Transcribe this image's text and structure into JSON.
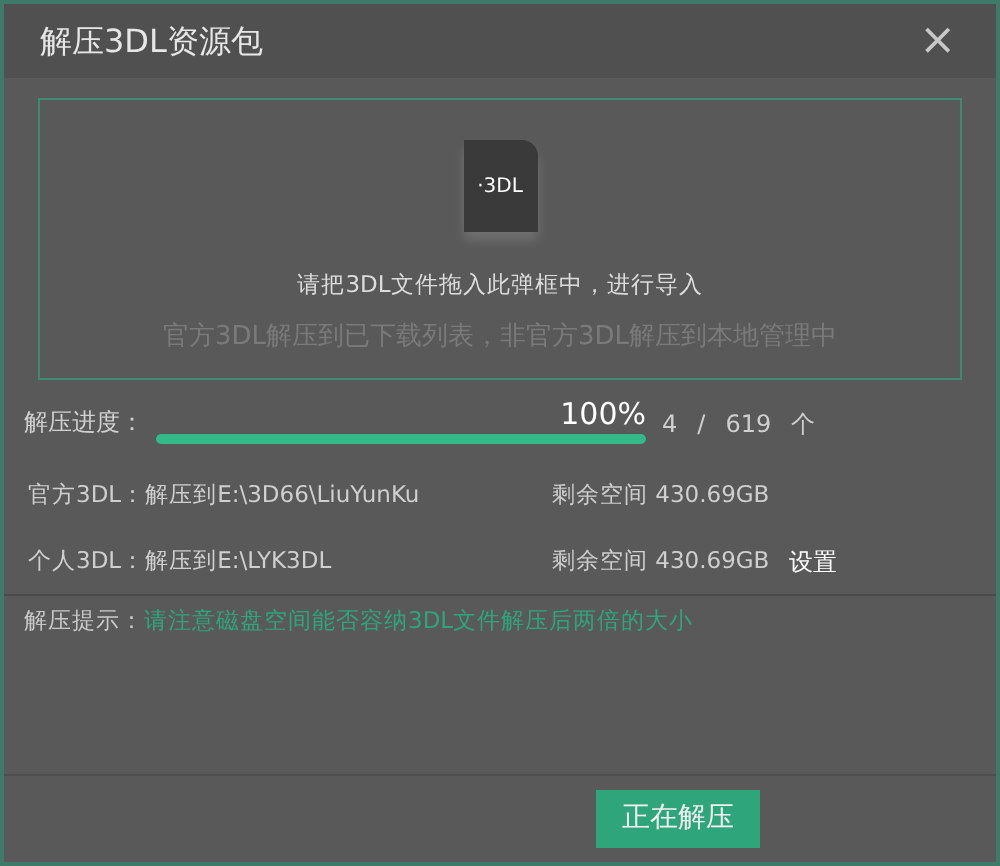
{
  "window": {
    "title": "解压3DL资源包",
    "close": "×"
  },
  "drop_zone": {
    "file_icon_label": "·3DL",
    "instruction": "请把3DL文件拖入此弹框中，进行导入",
    "note": "官方3DL解压到已下载列表，非官方3DL解压到本地管理中"
  },
  "progress": {
    "label": "解压进度：",
    "level": 1,
    "percent": "100%",
    "count": "4",
    "separator": "/",
    "total": "619",
    "unit": "个"
  },
  "destinations": [
    {
      "label": "官方3DL：解压到E:\\3D66\\LiuYunKu",
      "space": "剩余空间 430.69GB"
    },
    {
      "label": "个人3DL：解压到E:\\LYK3DL",
      "space": "剩余空间 430.69GB",
      "link": "设置"
    }
  ],
  "hint": {
    "label": "解压提示：",
    "text": "请注意磁盘空间能否容纳3DL文件解压后两倍的大小"
  },
  "buttons": [
    {
      "label": "正在解压"
    }
  ]
}
